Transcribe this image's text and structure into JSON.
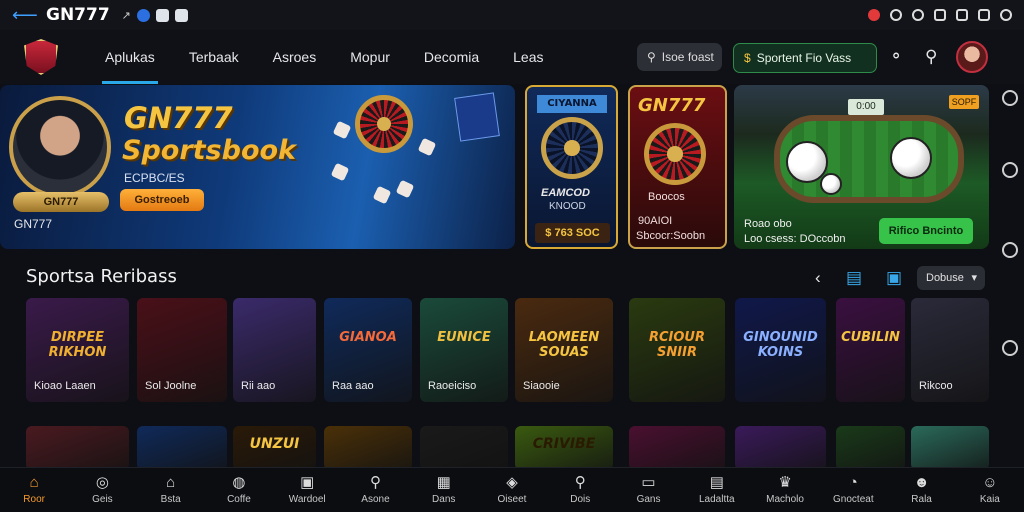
{
  "statusbar": {
    "back_icon": "arrow-left-icon",
    "title": "GN777"
  },
  "nav": {
    "tabs": [
      "Aplukas",
      "Terbaak",
      "Asroes",
      "Mopur",
      "Decomia",
      "Leas"
    ],
    "active_tab": 0,
    "search_label": "Isoe foast",
    "sports_button": "Sportent Fio Vass"
  },
  "banners": {
    "main": {
      "badge": "GN777",
      "brand": "GN777",
      "title1": "GN777",
      "title2": "Sportsbook",
      "subtitle": "ECPBC/ES",
      "cta": "Gostreoeb"
    },
    "b2": {
      "label": "CIYANNA",
      "line1": "EAMCOD",
      "line2": "KNOOD",
      "price": "$ 763 SOC"
    },
    "b3": {
      "label": "GN777",
      "line1": "Boocos",
      "line2": "90AIOI",
      "line3": "Sbcocr:Soobn"
    },
    "b4": {
      "score": "0:00",
      "tag": "SOPF",
      "line1": "Roao obo",
      "line2": "Loo csess: DOccobn",
      "cta": "Rifico Bncinto"
    }
  },
  "section": {
    "title": "Sportsa Reribass",
    "filter": "Dobuse"
  },
  "games_row1": [
    {
      "title": "DIRPEE RIKHON",
      "sub": "Kioao Laaen",
      "bg": "#3a1a4a",
      "tc": "#f0b030"
    },
    {
      "title": "",
      "sub": "Sol Joolne",
      "bg": "#4a1018",
      "tc": "#f5c542"
    },
    {
      "title": "",
      "sub": "Rii aao",
      "bg": "#3a2a6a",
      "tc": "#f5c542"
    },
    {
      "title": "GIANOA",
      "sub": "Raa aao",
      "bg": "#102a5a",
      "tc": "#f56a3a"
    },
    {
      "title": "EUNICE",
      "sub": "Raoeiciso",
      "bg": "#1a4a3a",
      "tc": "#f0c040"
    },
    {
      "title": "LAOMEEN SOUAS",
      "sub": "Siaooie",
      "bg": "#4a2a10",
      "tc": "#f5c542"
    },
    {
      "title": "RCIOUR SNIIR",
      "sub": "",
      "bg": "#2a3a10",
      "tc": "#f5a030"
    },
    {
      "title": "GINOUNID KOINS",
      "sub": "",
      "bg": "#10184a",
      "tc": "#8ab0ff"
    },
    {
      "title": "CUBILIN",
      "sub": "",
      "bg": "#3a1040",
      "tc": "#f5c542"
    },
    {
      "title": "",
      "sub": "Rikcoo",
      "bg": "#2a2a3a",
      "tc": "#f5c542"
    }
  ],
  "games_row2": [
    {
      "title": "",
      "bg": "#4a1a20",
      "tc": "#f5c542"
    },
    {
      "title": "",
      "bg": "#102a5a",
      "tc": "#f5c542"
    },
    {
      "title": "UNZUI",
      "bg": "#2a1a08",
      "tc": "#f5c542"
    },
    {
      "title": "",
      "bg": "#4a3008",
      "tc": "#f5c542"
    },
    {
      "title": "",
      "bg": "#1a1a1a",
      "tc": "#f5c542"
    },
    {
      "title": "CRIVIBE",
      "bg": "#3a5a10",
      "tc": "#2a1a00"
    },
    {
      "title": "",
      "bg": "#4a1030",
      "tc": "#f5c542"
    },
    {
      "title": "",
      "bg": "#3a1a5a",
      "tc": "#f5c542"
    },
    {
      "title": "",
      "bg": "#1a3a1a",
      "tc": "#f5c542"
    },
    {
      "title": "",
      "bg": "#2a6a5a",
      "tc": "#f5c542"
    }
  ],
  "bottom_nav": [
    {
      "label": "Roor",
      "icon": "home-icon",
      "glyph": "⌂"
    },
    {
      "label": "Geis",
      "icon": "ball-icon",
      "glyph": "◎"
    },
    {
      "label": "Bsta",
      "icon": "house-icon",
      "glyph": "⌂"
    },
    {
      "label": "Coffe",
      "icon": "compass-icon",
      "glyph": "◍"
    },
    {
      "label": "Wardoel",
      "icon": "wallet-icon",
      "glyph": "▣"
    },
    {
      "label": "Asone",
      "icon": "search-icon",
      "glyph": "⚲"
    },
    {
      "label": "Dans",
      "icon": "grid-icon",
      "glyph": "▦"
    },
    {
      "label": "Oiseet",
      "icon": "tag-icon",
      "glyph": "◈"
    },
    {
      "label": "Dois",
      "icon": "search-icon",
      "glyph": "⚲"
    },
    {
      "label": "Gans",
      "icon": "ticket-icon",
      "glyph": "▭"
    },
    {
      "label": "Ladaltta",
      "icon": "calendar-icon",
      "glyph": "▤"
    },
    {
      "label": "Macholo",
      "icon": "trophy-icon",
      "glyph": "♛"
    },
    {
      "label": "Gnocteat",
      "icon": "chat-icon",
      "glyph": "◔"
    },
    {
      "label": "Rala",
      "icon": "user-icon",
      "glyph": "☻"
    },
    {
      "label": "Kaia",
      "icon": "account-icon",
      "glyph": "☺"
    }
  ]
}
